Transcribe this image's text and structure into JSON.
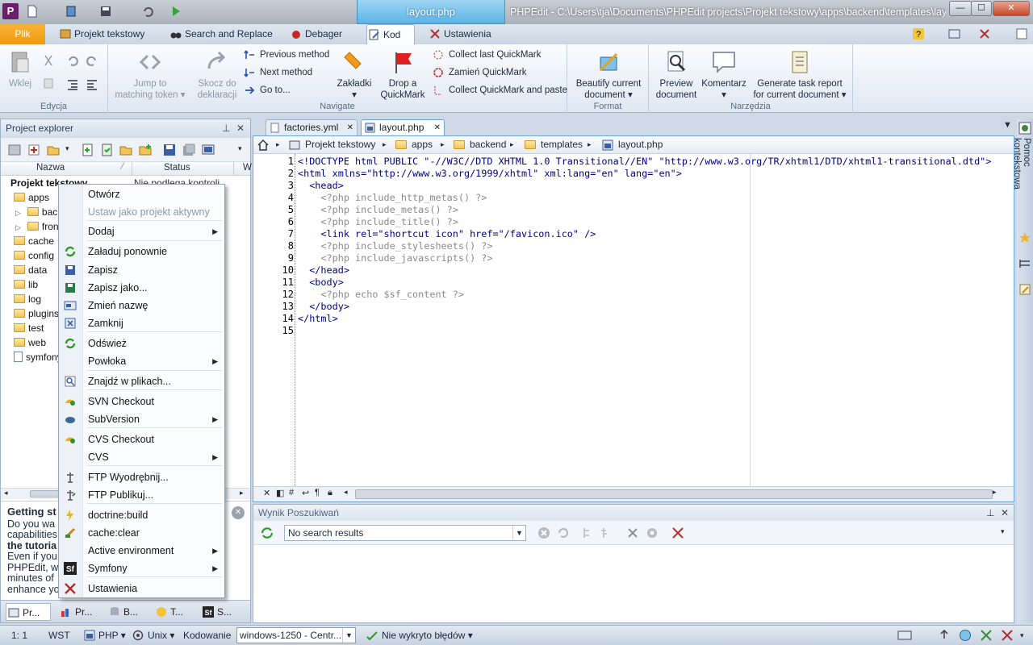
{
  "titlebar": {
    "app_icon_letter": "P",
    "context_tab": "layout.php",
    "title": "PHPEdit - C:\\Users\\tja\\Documents\\PHPEdit projects\\Projekt tekstowy\\apps\\backend\\templates\\lay...",
    "min": "—",
    "max": "☐",
    "close": "✕"
  },
  "ribbon_tabs": {
    "file": "Plik",
    "tabs": [
      "Projekt tekstowy",
      "Search and Replace",
      "Debager",
      "Kod",
      "Ustawienia"
    ],
    "active": "Kod"
  },
  "ribbon": {
    "edycja": {
      "label": "Edycja",
      "paste": "Wklej"
    },
    "navigate": {
      "label": "Navigate",
      "jump": "Jump to\nmatching token ▾",
      "jump_l1": "Jump to",
      "jump_l2": "matching token ▾",
      "skocz_l1": "Skocz do",
      "skocz_l2": "deklaracji",
      "prev_method": "Previous method",
      "next_method": "Next method",
      "goto": "Go to...",
      "zakladki": "Zakładki",
      "drop_l1": "Drop a",
      "drop_l2": "QuickMark",
      "collect_last": "Collect last QuickMark",
      "zamien": "Zamień QuickMark",
      "collect_paste": "Collect QuickMark and paste"
    },
    "format": {
      "label": "Format",
      "beautify_l1": "Beautify current",
      "beautify_l2": "document ▾"
    },
    "narzedzia": {
      "label": "Narzędzia",
      "preview_l1": "Preview",
      "preview_l2": "document",
      "komentarz": "Komentarz",
      "gen_l1": "Generate task report",
      "gen_l2": "for current document ▾"
    }
  },
  "project_explorer": {
    "title": "Project explorer",
    "col_name": "Nazwa",
    "col_status": "Status",
    "col_w": "W",
    "root": "Projekt tekstowy",
    "root_status": "Nie podlega kontroli",
    "items": [
      "apps",
      "back",
      "fron",
      "cache",
      "config",
      "data",
      "lib",
      "log",
      "plugins",
      "test",
      "web",
      "symfony"
    ],
    "getting_started": {
      "heading": "Getting st",
      "l1": "Do you wa",
      "l2": "capabilities",
      "l3": "the tutoria",
      "l4": "Even if you",
      "l5": "PHPEdit, we",
      "l6": "minutes of",
      "l7": "enhance yo"
    },
    "bottom_tabs": [
      "Pr...",
      "Pr...",
      "B...",
      "T...",
      "S..."
    ]
  },
  "context_menu": {
    "items": [
      {
        "label": "Otwórz"
      },
      {
        "label": "Ustaw jako projekt aktywny"
      },
      {
        "label": "Dodaj"
      },
      {
        "label": "Załaduj ponownie"
      },
      {
        "label": "Zapisz"
      },
      {
        "label": "Zapisz jako..."
      },
      {
        "label": "Zmień nazwę"
      },
      {
        "label": "Zamknij"
      },
      {
        "label": "Odśwież"
      },
      {
        "label": "Powłoka"
      },
      {
        "label": "Znajdź w plikach..."
      },
      {
        "label": "SVN Checkout"
      },
      {
        "label": "SubVersion"
      },
      {
        "label": "CVS Checkout"
      },
      {
        "label": "CVS"
      },
      {
        "label": "FTP Wyodrębnij..."
      },
      {
        "label": "FTP Publikuj..."
      },
      {
        "label": "doctrine:build"
      },
      {
        "label": "cache:clear"
      },
      {
        "label": "Active environment"
      },
      {
        "label": "Symfony"
      },
      {
        "label": "Ustawienia"
      }
    ]
  },
  "editor": {
    "tabs": [
      "factories.yml",
      "layout.php"
    ],
    "active_tab": "layout.php",
    "breadcrumb": [
      "Projekt tekstowy",
      "apps",
      "backend",
      "templates",
      "layout.php"
    ],
    "line_numbers": [
      "1",
      "2",
      "3",
      "4",
      "5",
      "6",
      "7",
      "8",
      "9",
      "10",
      "11",
      "12",
      "13",
      "14",
      "15"
    ],
    "lines": [
      "<!DOCTYPE html PUBLIC \"-//W3C//DTD XHTML 1.0 Transitional//EN\" \"http://www.w3.org/TR/xhtml1/DTD/xhtml1-transitional.dtd\">",
      "<html xmlns=\"http://www.w3.org/1999/xhtml\" xml:lang=\"en\" lang=\"en\">",
      "  <head>",
      "    <?php include_http_metas() ?>",
      "    <?php include_metas() ?>",
      "    <?php include_title() ?>",
      "    <link rel=\"shortcut icon\" href=\"/favicon.ico\" />",
      "    <?php include_stylesheets() ?>",
      "    <?php include_javascripts() ?>",
      "  </head>",
      "  <body>",
      "    <?php echo $sf_content ?>",
      "  </body>",
      "</html>",
      ""
    ]
  },
  "search": {
    "title": "Wynik Poszukiwań",
    "value": "No search results"
  },
  "sidebar": {
    "label": "Pomoc kontekstowa"
  },
  "status": {
    "position": "1:  1",
    "mode": "WST",
    "lang": "PHP ▾",
    "eol": "Unix ▾",
    "enc_label": "Kodowanie",
    "enc_value": "windows-1250 - Centr...",
    "errors": "Nie wykryto błędów ▾"
  },
  "colors": {
    "accent": "#5db4e6",
    "file_tab": "#f09a0e",
    "code_tag": "#00008b",
    "code_php": "#8a8a8a"
  }
}
